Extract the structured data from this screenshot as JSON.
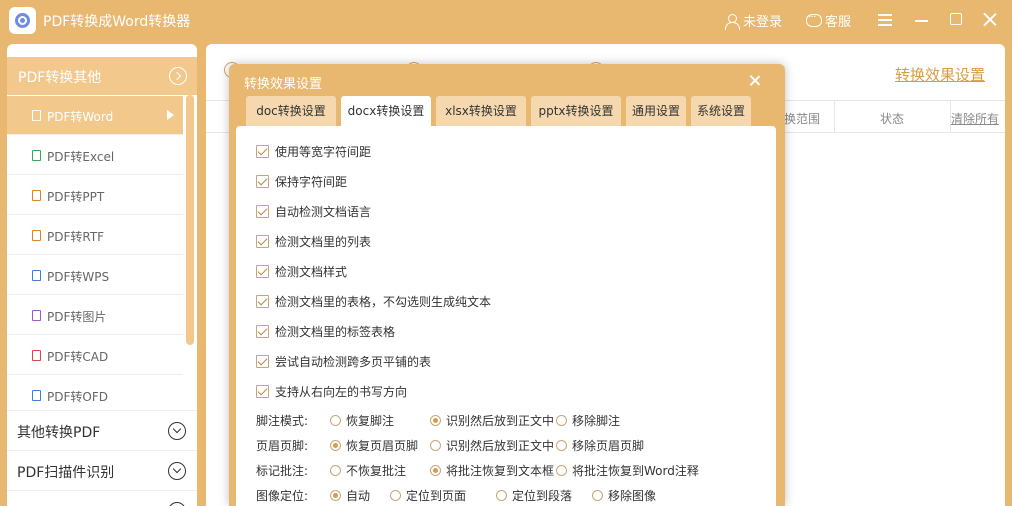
{
  "app": {
    "title": "PDF转换成Word转换器"
  },
  "titlebar": {
    "login": "未登录",
    "service": "客服"
  },
  "sidebar": {
    "header": "PDF转换其他",
    "items": [
      {
        "label": "PDF转Word",
        "color": "#f2c88d"
      },
      {
        "label": "PDF转Excel",
        "color": "#3aa65a"
      },
      {
        "label": "PDF转PPT",
        "color": "#e0822a"
      },
      {
        "label": "PDF转RTF",
        "color": "#e0822a"
      },
      {
        "label": "PDF转WPS",
        "color": "#3e7ed8"
      },
      {
        "label": "PDF转图片",
        "color": "#9b59c9"
      },
      {
        "label": "PDF转CAD",
        "color": "#d94545"
      },
      {
        "label": "PDF转OFD",
        "color": "#3e7ed8"
      }
    ],
    "groups": [
      "其他转换PDF",
      "PDF扫描件识别"
    ]
  },
  "main": {
    "settings_link": "转换效果设置",
    "table_headers": {
      "range": "转换范围",
      "status": "状态",
      "clear": "清除所有"
    }
  },
  "dialog": {
    "title": "转换效果设置",
    "tabs": [
      "doc转换设置",
      "docx转换设置",
      "xlsx转换设置",
      "pptx转换设置",
      "通用设置",
      "系统设置"
    ],
    "active_tab": "docx转换设置",
    "checkboxes": [
      "使用等宽字符间距",
      "保持字符间距",
      "自动检测文档语言",
      "检测文档里的列表",
      "检测文档样式",
      "检测文档里的表格，不勾选则生成纯文本",
      "检测文档里的标签表格",
      "尝试自动检测跨多页平铺的表",
      "支持从右向左的书写方向"
    ],
    "options": [
      {
        "label": "脚注模式:",
        "choices": [
          "恢复脚注",
          "识别然后放到正文中",
          "移除脚注"
        ],
        "selected": 1
      },
      {
        "label": "页眉页脚:",
        "choices": [
          "恢复页眉页脚",
          "识别然后放到正文中",
          "移除页眉页脚"
        ],
        "selected": 0
      },
      {
        "label": "标记批注:",
        "choices": [
          "不恢复批注",
          "将批注恢复到文本框",
          "将批注恢复到Word注释"
        ],
        "selected": 1
      },
      {
        "label": "图像定位:",
        "choices": [
          "自动",
          "定位到页面",
          "定位到段落",
          "移除图像"
        ],
        "selected": 0
      }
    ]
  }
}
